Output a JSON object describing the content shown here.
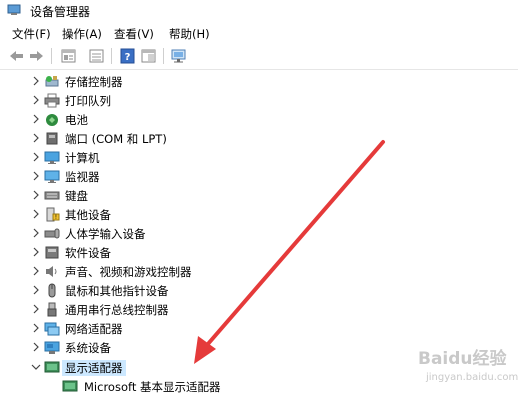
{
  "window": {
    "title": "设备管理器"
  },
  "menu": {
    "items": [
      "文件(F)",
      "操作(A)",
      "查看(V)",
      "帮助(H)"
    ]
  },
  "tree": {
    "categories": [
      {
        "label": "存储控制器",
        "icon": "storage-controller-icon"
      },
      {
        "label": "打印队列",
        "icon": "print-queue-icon"
      },
      {
        "label": "电池",
        "icon": "battery-icon"
      },
      {
        "label": "端口 (COM 和 LPT)",
        "icon": "port-icon"
      },
      {
        "label": "计算机",
        "icon": "computer-icon"
      },
      {
        "label": "监视器",
        "icon": "monitor-icon"
      },
      {
        "label": "键盘",
        "icon": "keyboard-icon"
      },
      {
        "label": "其他设备",
        "icon": "other-device-icon"
      },
      {
        "label": "人体学输入设备",
        "icon": "hid-icon"
      },
      {
        "label": "软件设备",
        "icon": "software-device-icon"
      },
      {
        "label": "声音、视频和游戏控制器",
        "icon": "sound-icon"
      },
      {
        "label": "鼠标和其他指针设备",
        "icon": "mouse-icon"
      },
      {
        "label": "通用串行总线控制器",
        "icon": "usb-icon"
      },
      {
        "label": "网络适配器",
        "icon": "network-adapter-icon"
      },
      {
        "label": "系统设备",
        "icon": "system-device-icon"
      },
      {
        "label": "显示适配器",
        "icon": "display-adapter-icon",
        "expanded": true
      }
    ],
    "display_adapter_child": {
      "label": "Microsoft 基本显示适配器",
      "icon": "display-adapter-icon"
    }
  },
  "watermark": {
    "brand": "Baidu经验",
    "domain": "jingyan.baidu.com"
  },
  "colors": {
    "selection": "#cce8ff",
    "annotation_arrow": "#e53a3a"
  }
}
